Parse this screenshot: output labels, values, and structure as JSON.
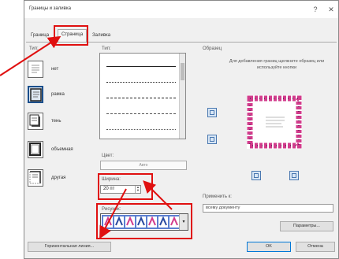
{
  "dialog": {
    "title": "Границы и заливка",
    "help_glyph": "?",
    "close_glyph": "✕"
  },
  "tabs": [
    {
      "label": "Граница"
    },
    {
      "label": "Страница",
      "selected": true
    },
    {
      "label": "Заливка"
    }
  ],
  "setting": {
    "label": "Тип:",
    "items": [
      {
        "label": "нет"
      },
      {
        "label": "рамка",
        "selected": true
      },
      {
        "label": "тень"
      },
      {
        "label": "объемная"
      },
      {
        "label": "другая"
      }
    ]
  },
  "style": {
    "label": "Тип:"
  },
  "color": {
    "label": "Цвет:",
    "value": "Авто"
  },
  "width": {
    "label": "Ширина:",
    "value": "20 пт"
  },
  "art": {
    "label": "Рисунок:"
  },
  "preview": {
    "label": "Образец",
    "hint": "Для добавления границ щелкните образец или используйте кнопки"
  },
  "apply": {
    "label": "Применить к:",
    "value": "всему документу"
  },
  "buttons": {
    "options": "Параметры...",
    "horizontal_line": "Горизонтальная линия...",
    "ok": "OK",
    "cancel": "Отмена"
  },
  "colors": {
    "highlight": "#e01010",
    "selection": "#1b4f8c",
    "art_pink": "#d23c8c",
    "art_blue": "#2a4aa0"
  }
}
